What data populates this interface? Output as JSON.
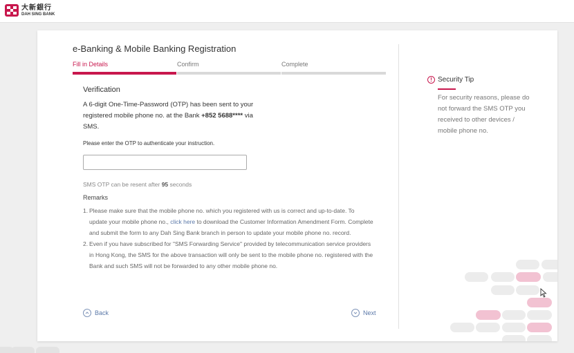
{
  "brand": {
    "name_cn": "大新銀行",
    "name_en": "DAH SING BANK",
    "color": "#c8174d"
  },
  "page": {
    "title": "e-Banking & Mobile Banking Registration"
  },
  "steps": [
    {
      "label": "Fill in Details",
      "active": true
    },
    {
      "label": "Confirm",
      "active": false
    },
    {
      "label": "Complete",
      "active": false
    }
  ],
  "verification": {
    "title": "Verification",
    "msg_part1": "A 6-digit One-Time-Password (OTP) has been sent to your registered mobile phone no. at the Bank ",
    "phone": "+852 5688****",
    "msg_part2": " via SMS.",
    "enter_prompt": "Please enter the OTP to authenticate your instruction.",
    "otp_value": "",
    "otp_placeholder": "",
    "resend_prefix": "SMS OTP can be resent after ",
    "resend_seconds": "95",
    "resend_suffix": " seconds"
  },
  "remarks": {
    "title": "Remarks",
    "item1_num": "1.",
    "item1_a": "Please make sure that the mobile phone no. which you registered with us is correct and up-to-date. To update your mobile phone no., ",
    "item1_link": "click here",
    "item1_b": " to download the Customer Information Amendment Form. Complete and submit the form to any Dah Sing Bank branch in person to update your mobile phone no. record.",
    "item2_num": "2.",
    "item2": "Even if you have subscribed for \"SMS Forwarding Service\" provided by telecommunication service providers in Hong Kong, the SMS for the above transaction will only be sent to the mobile phone no. registered with the Bank and such SMS will not be forwarded to any other mobile phone no."
  },
  "nav": {
    "back_label": "Back",
    "next_label": "Next"
  },
  "security_tip": {
    "title": "Security Tip",
    "icon": "exclamation-icon",
    "body": "For security reasons, please do not forward the SMS OTP you received to other devices / mobile phone no."
  }
}
